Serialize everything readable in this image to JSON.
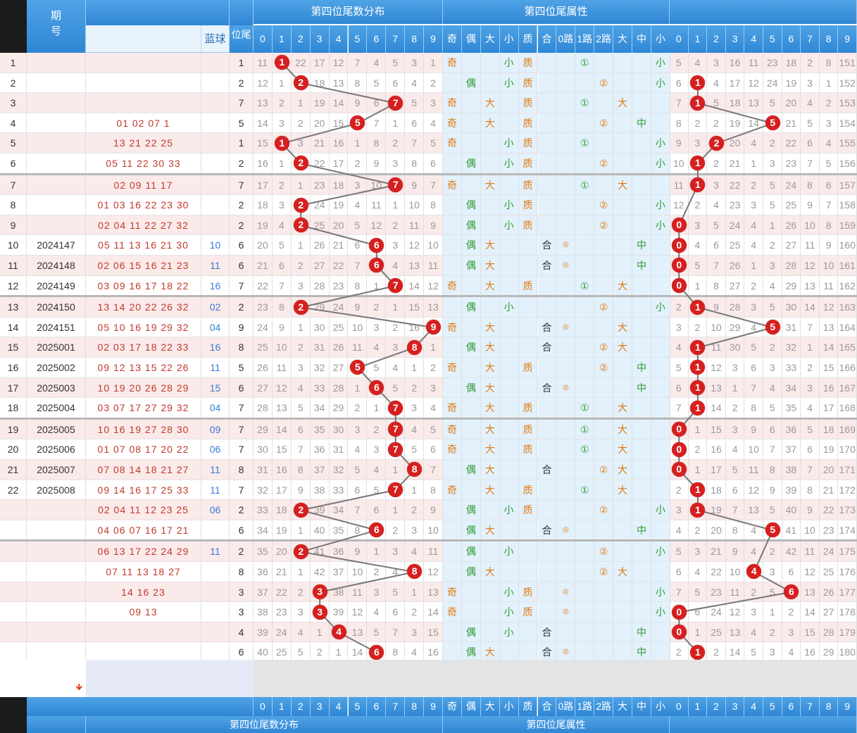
{
  "header": {
    "issue_label": "期\n号",
    "blue_label": "蓝球",
    "pos_label": "位尾",
    "section_dist": "第四位尾数分布",
    "section_attr": "第四位尾属性",
    "digits": [
      "0",
      "1",
      "2",
      "3",
      "4",
      "5",
      "6",
      "7",
      "8",
      "9"
    ],
    "attr_cols": [
      "奇",
      "偶",
      "大",
      "小",
      "质",
      "合",
      "0路",
      "1路",
      "2路",
      "大",
      "中",
      "小"
    ],
    "arrow_icon": "down-arrow-icon"
  },
  "footer": {
    "section_dist": "第四位尾数分布",
    "section_attr": "第四位尾属性"
  },
  "colors": {
    "header": "#3a95dd",
    "ball": "#d71f1f",
    "odd_row": "#fbeaea",
    "prop_bg": "#e2f1fc"
  },
  "rows": [
    {
      "idx": "1",
      "issue": "",
      "nums": "",
      "blue": "",
      "pos": "1",
      "dist": [
        11,
        1,
        22,
        17,
        12,
        7,
        4,
        5,
        3,
        1
      ],
      "attr": [
        "奇",
        "",
        "",
        "小",
        "质",
        "",
        "",
        "①",
        "",
        "",
        "",
        "小"
      ],
      "tail": [
        5,
        4,
        3,
        16,
        11,
        23,
        18,
        2,
        8,
        151
      ]
    },
    {
      "idx": "2",
      "issue": "",
      "nums": "",
      "blue": "",
      "pos": "2",
      "dist": [
        12,
        1,
        2,
        18,
        13,
        8,
        5,
        6,
        4,
        2
      ],
      "attr": [
        "",
        "偶",
        "",
        "小",
        "质",
        "",
        "",
        "",
        "②",
        "",
        "",
        "小"
      ],
      "tail": [
        6,
        1,
        4,
        17,
        12,
        24,
        19,
        3,
        1,
        152
      ]
    },
    {
      "idx": "3",
      "issue": "",
      "nums": "",
      "blue": "",
      "pos": "7",
      "dist": [
        13,
        2,
        1,
        19,
        14,
        9,
        6,
        7,
        5,
        3
      ],
      "attr": [
        "奇",
        "",
        "大",
        "",
        "质",
        "",
        "",
        "①",
        "",
        "大",
        "",
        ""
      ],
      "tail": [
        7,
        1,
        5,
        18,
        13,
        5,
        20,
        4,
        2,
        153
      ]
    },
    {
      "idx": "4",
      "issue": "",
      "nums": "01 02 07 1",
      "blue": "",
      "pos": "5",
      "dist": [
        14,
        3,
        2,
        20,
        15,
        5,
        7,
        1,
        6,
        4
      ],
      "attr": [
        "奇",
        "",
        "大",
        "",
        "质",
        "",
        "",
        "",
        "②",
        "",
        "中",
        ""
      ],
      "tail": [
        8,
        2,
        2,
        19,
        14,
        1,
        21,
        5,
        3,
        154
      ]
    },
    {
      "idx": "5",
      "issue": "",
      "nums": "13 21 22 25",
      "blue": "",
      "pos": "1",
      "dist": [
        15,
        1,
        3,
        21,
        16,
        1,
        8,
        2,
        7,
        5
      ],
      "attr": [
        "奇",
        "",
        "",
        "小",
        "质",
        "",
        "",
        "①",
        "",
        "",
        "",
        "小"
      ],
      "tail": [
        9,
        3,
        1,
        20,
        4,
        2,
        22,
        6,
        4,
        155
      ]
    },
    {
      "idx": "6",
      "issue": "",
      "nums": "05 11 22 30 33",
      "blue": "",
      "pos": "2",
      "dist": [
        16,
        1,
        2,
        22,
        17,
        2,
        9,
        3,
        8,
        6
      ],
      "attr": [
        "",
        "偶",
        "",
        "小",
        "质",
        "",
        "",
        "",
        "②",
        "",
        "",
        "小"
      ],
      "tail": [
        10,
        1,
        2,
        21,
        1,
        3,
        23,
        7,
        5,
        156
      ]
    },
    {
      "idx": "7",
      "issue": "",
      "nums": "02 09 11 17",
      "blue": "",
      "pos": "7",
      "dist": [
        17,
        2,
        1,
        23,
        18,
        3,
        10,
        7,
        9,
        7
      ],
      "attr": [
        "奇",
        "",
        "大",
        "",
        "质",
        "",
        "",
        "①",
        "",
        "大",
        "",
        ""
      ],
      "tail": [
        11,
        1,
        3,
        22,
        2,
        5,
        24,
        8,
        6,
        157
      ]
    },
    {
      "idx": "8",
      "issue": "",
      "nums": "01 03 16 22 23 30",
      "blue": "",
      "pos": "2",
      "dist": [
        18,
        3,
        2,
        24,
        19,
        4,
        11,
        1,
        10,
        8
      ],
      "attr": [
        "",
        "偶",
        "",
        "小",
        "质",
        "",
        "",
        "",
        "②",
        "",
        "",
        "小"
      ],
      "tail": [
        12,
        2,
        4,
        23,
        3,
        5,
        25,
        9,
        7,
        158
      ]
    },
    {
      "idx": "9",
      "issue": "",
      "nums": "02 04 11 22 27 32",
      "blue": "",
      "pos": "2",
      "dist": [
        19,
        4,
        2,
        25,
        20,
        5,
        12,
        2,
        11,
        9
      ],
      "attr": [
        "",
        "偶",
        "",
        "小",
        "质",
        "",
        "",
        "",
        "②",
        "",
        "",
        "小"
      ],
      "tail": [
        0,
        3,
        5,
        24,
        4,
        1,
        26,
        10,
        8,
        159
      ]
    },
    {
      "idx": "10",
      "issue": "2024147",
      "nums": "05 11 13 16 21 30",
      "blue": "10",
      "pos": "6",
      "dist": [
        20,
        5,
        1,
        26,
        21,
        6,
        6,
        3,
        12,
        10
      ],
      "attr": [
        "",
        "偶",
        "大",
        "",
        "",
        "合",
        "◎",
        "",
        "",
        "",
        "中",
        ""
      ],
      "tail": [
        1,
        4,
        6,
        25,
        4,
        2,
        27,
        11,
        9,
        160
      ]
    },
    {
      "idx": "11",
      "issue": "2024148",
      "nums": "02 06 15 16 21 23",
      "blue": "11",
      "pos": "6",
      "dist": [
        21,
        6,
        2,
        27,
        22,
        7,
        6,
        4,
        13,
        11
      ],
      "attr": [
        "",
        "偶",
        "大",
        "",
        "",
        "合",
        "◎",
        "",
        "",
        "",
        "中",
        ""
      ],
      "tail": [
        0,
        5,
        7,
        26,
        1,
        3,
        28,
        12,
        10,
        161
      ]
    },
    {
      "idx": "12",
      "issue": "2024149",
      "nums": "03 09 16 17 18 22",
      "blue": "16",
      "pos": "7",
      "dist": [
        22,
        7,
        3,
        28,
        23,
        8,
        1,
        7,
        14,
        12
      ],
      "attr": [
        "奇",
        "",
        "大",
        "",
        "质",
        "",
        "",
        "①",
        "",
        "大",
        "",
        ""
      ],
      "tail": [
        1,
        1,
        8,
        27,
        2,
        4,
        29,
        13,
        11,
        162
      ]
    },
    {
      "idx": "13",
      "issue": "2024150",
      "nums": "13 14 20 22 26 32",
      "blue": "02",
      "pos": "2",
      "dist": [
        23,
        8,
        2,
        29,
        24,
        9,
        2,
        1,
        15,
        13
      ],
      "attr": [
        "",
        "偶",
        "",
        "小",
        "",
        "",
        "",
        "",
        "②",
        "",
        "",
        "小"
      ],
      "tail": [
        2,
        1,
        9,
        28,
        3,
        5,
        30,
        14,
        12,
        163
      ]
    },
    {
      "idx": "14",
      "issue": "2024151",
      "nums": "05 10 16 19 29 32",
      "blue": "04",
      "pos": "9",
      "dist": [
        24,
        9,
        1,
        30,
        25,
        10,
        3,
        2,
        16,
        9
      ],
      "attr": [
        "奇",
        "",
        "大",
        "",
        "",
        "合",
        "◎",
        "",
        "",
        "大",
        "",
        ""
      ],
      "tail": [
        3,
        2,
        10,
        29,
        4,
        1,
        31,
        7,
        13,
        164
      ]
    },
    {
      "idx": "15",
      "issue": "2025001",
      "nums": "02 03 17 18 22 33",
      "blue": "16",
      "pos": "8",
      "dist": [
        25,
        10,
        2,
        31,
        26,
        11,
        4,
        3,
        8,
        1
      ],
      "attr": [
        "",
        "偶",
        "大",
        "",
        "",
        "合",
        "",
        "",
        "②",
        "大",
        "",
        ""
      ],
      "tail": [
        4,
        1,
        11,
        30,
        5,
        2,
        32,
        1,
        14,
        165
      ]
    },
    {
      "idx": "16",
      "issue": "2025002",
      "nums": "09 12 13 15 22 26",
      "blue": "11",
      "pos": "5",
      "dist": [
        26,
        11,
        3,
        32,
        27,
        5,
        5,
        4,
        1,
        2
      ],
      "attr": [
        "奇",
        "",
        "大",
        "",
        "质",
        "",
        "",
        "",
        "②",
        "",
        "中",
        ""
      ],
      "tail": [
        5,
        1,
        12,
        3,
        6,
        3,
        33,
        2,
        15,
        166
      ]
    },
    {
      "idx": "17",
      "issue": "2025003",
      "nums": "10 19 20 26 28 29",
      "blue": "15",
      "pos": "6",
      "dist": [
        27,
        12,
        4,
        33,
        28,
        1,
        6,
        5,
        2,
        3
      ],
      "attr": [
        "",
        "偶",
        "大",
        "",
        "",
        "合",
        "◎",
        "",
        "",
        "",
        "中",
        ""
      ],
      "tail": [
        6,
        1,
        13,
        1,
        7,
        4,
        34,
        3,
        16,
        167
      ]
    },
    {
      "idx": "18",
      "issue": "2025004",
      "nums": "03 07 17 27 29 32",
      "blue": "04",
      "pos": "7",
      "dist": [
        28,
        13,
        5,
        34,
        29,
        2,
        1,
        7,
        3,
        4
      ],
      "attr": [
        "奇",
        "",
        "大",
        "",
        "质",
        "",
        "",
        "①",
        "",
        "大",
        "",
        ""
      ],
      "tail": [
        7,
        1,
        14,
        2,
        8,
        5,
        35,
        4,
        17,
        168
      ]
    },
    {
      "idx": "19",
      "issue": "2025005",
      "nums": "10 16 19 27 28 30",
      "blue": "09",
      "pos": "7",
      "dist": [
        29,
        14,
        6,
        35,
        30,
        3,
        2,
        7,
        4,
        5
      ],
      "attr": [
        "奇",
        "",
        "大",
        "",
        "质",
        "",
        "",
        "①",
        "",
        "大",
        "",
        ""
      ],
      "tail": [
        0,
        1,
        15,
        3,
        9,
        6,
        36,
        5,
        18,
        169
      ]
    },
    {
      "idx": "20",
      "issue": "2025006",
      "nums": "01 07 08 17 20 22",
      "blue": "06",
      "pos": "7",
      "dist": [
        30,
        15,
        7,
        36,
        31,
        4,
        3,
        7,
        5,
        6
      ],
      "attr": [
        "奇",
        "",
        "大",
        "",
        "质",
        "",
        "",
        "①",
        "",
        "大",
        "",
        ""
      ],
      "tail": [
        0,
        2,
        16,
        4,
        10,
        7,
        37,
        6,
        19,
        170
      ]
    },
    {
      "idx": "21",
      "issue": "2025007",
      "nums": "07 08 14 18 21 27",
      "blue": "11",
      "pos": "8",
      "dist": [
        31,
        16,
        8,
        37,
        32,
        5,
        4,
        1,
        8,
        7
      ],
      "attr": [
        "",
        "偶",
        "大",
        "",
        "",
        "合",
        "",
        "",
        "②",
        "大",
        "",
        ""
      ],
      "tail": [
        1,
        1,
        17,
        5,
        11,
        8,
        38,
        7,
        20,
        171
      ]
    },
    {
      "idx": "22",
      "issue": "2025008",
      "nums": "09 14 16 17 25 33",
      "blue": "11",
      "pos": "7",
      "dist": [
        32,
        17,
        9,
        38,
        33,
        6,
        5,
        7,
        1,
        8
      ],
      "attr": [
        "奇",
        "",
        "大",
        "",
        "质",
        "",
        "",
        "①",
        "",
        "大",
        "",
        ""
      ],
      "tail": [
        2,
        1,
        18,
        6,
        12,
        9,
        39,
        8,
        21,
        172
      ]
    },
    {
      "idx": "",
      "issue": "",
      "nums": "02 04 11 12 23 25",
      "blue": "06",
      "pos": "2",
      "dist": [
        33,
        18,
        2,
        39,
        34,
        7,
        6,
        1,
        2,
        9
      ],
      "attr": [
        "",
        "偶",
        "",
        "小",
        "质",
        "",
        "",
        "",
        "②",
        "",
        "",
        "小"
      ],
      "tail": [
        3,
        1,
        19,
        7,
        13,
        5,
        40,
        9,
        22,
        173
      ]
    },
    {
      "idx": "",
      "issue": "",
      "nums": "04 06 07 16 17 21",
      "blue": "",
      "pos": "6",
      "dist": [
        34,
        19,
        1,
        40,
        35,
        8,
        6,
        2,
        3,
        10
      ],
      "attr": [
        "",
        "偶",
        "大",
        "",
        "",
        "合",
        "◎",
        "",
        "",
        "",
        "中",
        ""
      ],
      "tail": [
        4,
        2,
        20,
        8,
        4,
        1,
        41,
        10,
        23,
        174
      ]
    },
    {
      "idx": "",
      "issue": "",
      "nums": "06 13 17 22 24 29",
      "blue": "11",
      "pos": "2",
      "dist": [
        35,
        20,
        2,
        41,
        36,
        9,
        1,
        3,
        4,
        11
      ],
      "attr": [
        "",
        "偶",
        "",
        "小",
        "",
        "",
        "",
        "",
        "②",
        "",
        "",
        "小"
      ],
      "tail": [
        5,
        3,
        21,
        9,
        4,
        2,
        42,
        11,
        24,
        175
      ]
    },
    {
      "idx": "",
      "issue": "",
      "nums": "07 11 13 18 27",
      "blue": "",
      "pos": "8",
      "dist": [
        36,
        21,
        1,
        42,
        37,
        10,
        2,
        4,
        8,
        12
      ],
      "attr": [
        "",
        "偶",
        "大",
        "",
        "",
        "",
        "",
        "",
        "②",
        "大",
        "",
        ""
      ],
      "tail": [
        6,
        4,
        22,
        10,
        1,
        3,
        6,
        12,
        25,
        176
      ]
    },
    {
      "idx": "",
      "issue": "",
      "nums": "14 16 23",
      "blue": "",
      "pos": "3",
      "dist": [
        37,
        22,
        2,
        3,
        38,
        11,
        3,
        5,
        1,
        13
      ],
      "attr": [
        "奇",
        "",
        "",
        "小",
        "质",
        "",
        "◎",
        "",
        "",
        "",
        "",
        "小"
      ],
      "tail": [
        7,
        5,
        23,
        11,
        2,
        5,
        1,
        13,
        26,
        177
      ]
    },
    {
      "idx": "",
      "issue": "",
      "nums": "09 13",
      "blue": "",
      "pos": "3",
      "dist": [
        38,
        23,
        3,
        3,
        39,
        12,
        4,
        6,
        2,
        14
      ],
      "attr": [
        "奇",
        "",
        "",
        "小",
        "质",
        "",
        "◎",
        "",
        "",
        "",
        "",
        "小"
      ],
      "tail": [
        0,
        6,
        24,
        12,
        3,
        1,
        2,
        14,
        27,
        178
      ]
    },
    {
      "idx": "",
      "issue": "",
      "nums": "",
      "blue": "",
      "pos": "4",
      "dist": [
        39,
        24,
        4,
        1,
        4,
        13,
        5,
        7,
        3,
        15
      ],
      "attr": [
        "",
        "偶",
        "",
        "小",
        "",
        "合",
        "",
        "",
        "",
        "",
        "中",
        ""
      ],
      "tail": [
        1,
        1,
        25,
        13,
        4,
        2,
        3,
        15,
        28,
        179
      ]
    },
    {
      "idx": "",
      "issue": "",
      "nums": "",
      "blue": "",
      "pos": "6",
      "dist": [
        40,
        25,
        5,
        2,
        1,
        14,
        6,
        8,
        4,
        16
      ],
      "attr": [
        "",
        "偶",
        "大",
        "",
        "",
        "合",
        "◎",
        "",
        "",
        "",
        "中",
        ""
      ],
      "tail": [
        2,
        1,
        2,
        14,
        5,
        3,
        4,
        16,
        29,
        180
      ]
    }
  ]
}
